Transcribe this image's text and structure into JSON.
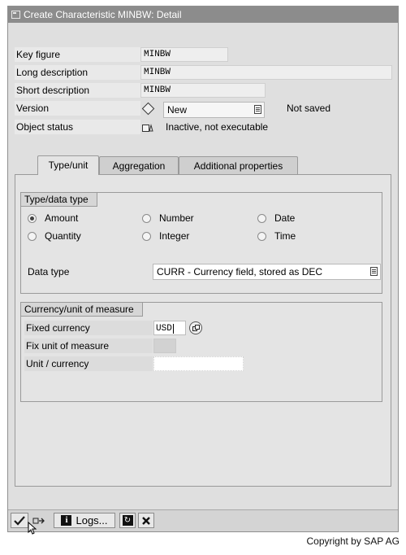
{
  "window": {
    "title": "Create Characteristic MINBW: Detail"
  },
  "fields": {
    "key_figure": {
      "label": "Key figure",
      "value": "MINBW"
    },
    "long_description": {
      "label": "Long description",
      "value": "MINBW"
    },
    "short_description": {
      "label": "Short description",
      "value": "MINBW"
    },
    "version": {
      "label": "Version",
      "value": "New",
      "status": "Not saved"
    },
    "object_status": {
      "label": "Object status",
      "value": "Inactive, not executable"
    }
  },
  "tabs": [
    {
      "label": "Type/unit",
      "active": true
    },
    {
      "label": "Aggregation",
      "active": false
    },
    {
      "label": "Additional properties",
      "active": false
    }
  ],
  "type_group": {
    "title": "Type/data type",
    "options": [
      {
        "label": "Amount",
        "selected": true
      },
      {
        "label": "Number",
        "selected": false
      },
      {
        "label": "Date",
        "selected": false
      },
      {
        "label": "Quantity",
        "selected": false
      },
      {
        "label": "Integer",
        "selected": false
      },
      {
        "label": "Time",
        "selected": false
      }
    ],
    "data_type_label": "Data type",
    "data_type_value": "CURR - Currency field, stored as DEC"
  },
  "currency_group": {
    "title": "Currency/unit of measure",
    "fixed_currency": {
      "label": "Fixed currency",
      "value": "USD"
    },
    "fix_unit": {
      "label": "Fix unit of measure",
      "value": ""
    },
    "unit_currency": {
      "label": "Unit / currency",
      "value": ""
    }
  },
  "toolbar": {
    "logs_label": "Logs..."
  },
  "footer": {
    "copyright": "Copyright by SAP AG"
  }
}
